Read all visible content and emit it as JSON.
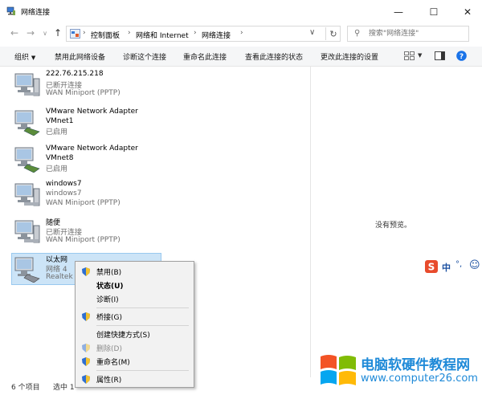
{
  "window": {
    "title": "网络连接"
  },
  "address": {
    "crumbs": [
      "控制面板",
      "网络和 Internet",
      "网络连接"
    ],
    "search_placeholder": "搜索\"网络连接\""
  },
  "commands": [
    "组织",
    "禁用此网络设备",
    "诊断这个连接",
    "重命名此连接",
    "查看此连接的状态",
    "更改此连接的设置"
  ],
  "connections": [
    {
      "name": "222.76.215.218",
      "status": "已断开连接",
      "device": "WAN Miniport (PPTP)",
      "icon": "dialup-connection-icon"
    },
    {
      "name": "VMware Network Adapter VMnet1",
      "status": "已启用",
      "device": "",
      "icon": "network-adapter-icon"
    },
    {
      "name": "VMware Network Adapter VMnet8",
      "status": "已启用",
      "device": "",
      "icon": "network-adapter-icon"
    },
    {
      "name": "windows7",
      "status": "windows7",
      "device": "WAN Miniport (PPTP)",
      "icon": "dialup-connection-icon"
    },
    {
      "name": "随便",
      "status": "已断开连接",
      "device": "WAN Miniport (PPTP)",
      "icon": "dialup-connection-icon"
    },
    {
      "name": "以太网",
      "status": "网络 4",
      "device": "Realtek I",
      "icon": "ethernet-adapter-icon",
      "selected": true
    }
  ],
  "preview": {
    "empty_text": "没有预览。"
  },
  "status_bar": {
    "item_count": "6 个项目",
    "selected": "选中 1"
  },
  "context_menu": {
    "items": [
      {
        "label": "禁用(B)",
        "icon": "shield-icon"
      },
      {
        "label": "状态(U)",
        "bold": true
      },
      {
        "label": "诊断(I)"
      },
      {
        "label": "桥接(G)",
        "icon": "shield-icon"
      },
      {
        "label": "创建快捷方式(S)"
      },
      {
        "label": "删除(D)",
        "icon": "shield-icon",
        "disabled": true
      },
      {
        "label": "重命名(M)",
        "icon": "shield-icon"
      },
      {
        "label": "属性(R)",
        "icon": "shield-icon"
      }
    ]
  },
  "ime": {
    "mode": "中",
    "punct": "°,"
  },
  "watermark": {
    "title": "电脑软硬件教程网",
    "url": "www.computer26.com"
  },
  "colors": {
    "selection": "#cce4f7",
    "help": "#1a73e8",
    "watermark": "#1f8ad8"
  }
}
